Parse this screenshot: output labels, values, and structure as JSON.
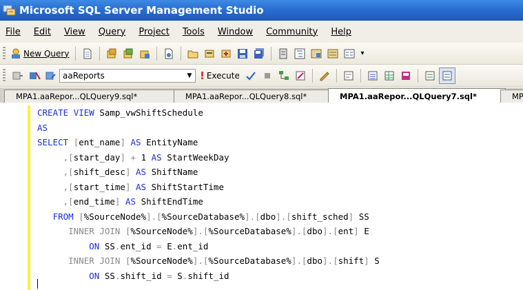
{
  "window": {
    "title": "Microsoft SQL Server Management Studio"
  },
  "menu": [
    "File",
    "Edit",
    "View",
    "Query",
    "Project",
    "Tools",
    "Window",
    "Community",
    "Help"
  ],
  "toolbar": {
    "new_query_label": "New Query",
    "database_selector": "aaReports",
    "execute_label": "Execute"
  },
  "tabs": [
    {
      "label": "MPA1.aaRepor...QLQuery9.sql*"
    },
    {
      "label": "MPA1.aaRepor...QLQuery8.sql*"
    },
    {
      "label": "MPA1.aaRepor...QLQuery7.sql*"
    },
    {
      "label": "MPA"
    }
  ],
  "editor": {
    "lines": [
      "CREATE VIEW Samp_vwShiftSchedule",
      "AS",
      "SELECT [ent_name] AS EntityName",
      "     ,[start_day] + 1 AS StartWeekDay",
      "     ,[shift_desc] AS ShiftName",
      "     ,[start_time] AS ShiftStartTime",
      "     ,[end_time] AS ShiftEndTime",
      "   FROM [%SourceNode%].[%SourceDatabase%].[dbo].[shift_sched] SS",
      "      INNER JOIN [%SourceNode%].[%SourceDatabase%].[dbo].[ent] E",
      "          ON SS.ent_id = E.ent_id",
      "      INNER JOIN [%SourceNode%].[%SourceDatabase%].[dbo].[shift] S",
      "          ON SS.shift_id = S.shift_id"
    ]
  },
  "colors": {
    "keyword": "#1a2fd6",
    "operator": "#8a8a8a",
    "title_bar": "#2a6fd2"
  }
}
